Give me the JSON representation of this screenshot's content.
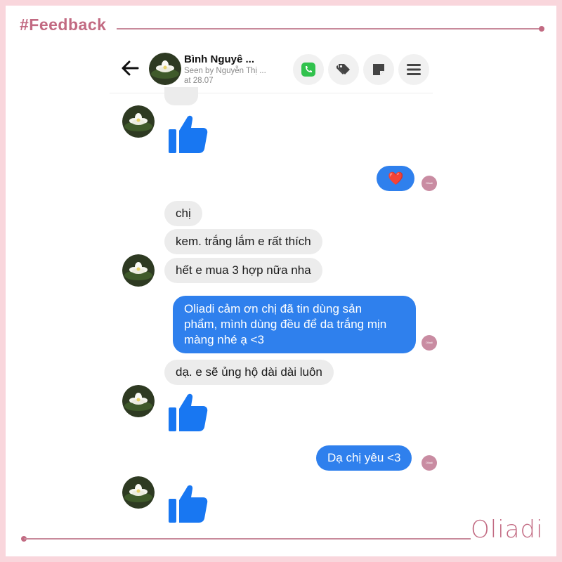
{
  "page": {
    "heading": "#Feedback",
    "brand": "Oliadi"
  },
  "header": {
    "contact_name": "Bình Nguyê ...",
    "seen_by": "Seen by Nguyễn Thị ...",
    "seen_time": "at 28.07",
    "icons": [
      "back-arrow-icon",
      "phone-icon",
      "tag-icon",
      "note-icon",
      "menu-icon"
    ]
  },
  "messages": {
    "heart": "❤️",
    "m1": "chị",
    "m2": "kem. trắng lắm e rất thích",
    "m3": "hết e mua 3 hợp nữa nha",
    "m4_line1": "Oliadi cảm ơn chị đã tin dùng sản",
    "m4_line2": "phẩm, mình dùng đều để da trắng mịn",
    "m4_line3": "màng nhé ạ <3",
    "m5": "dạ. e sẽ ủng hộ dài dài luôn",
    "m6": "Dạ chị yêu <3",
    "seen_label": "Oliadi"
  },
  "colors": {
    "accent": "#c26a82",
    "border": "#f9d6dc",
    "outgoing_bubble": "#2f80ed",
    "incoming_bubble": "#ececec",
    "like": "#1877f2"
  }
}
